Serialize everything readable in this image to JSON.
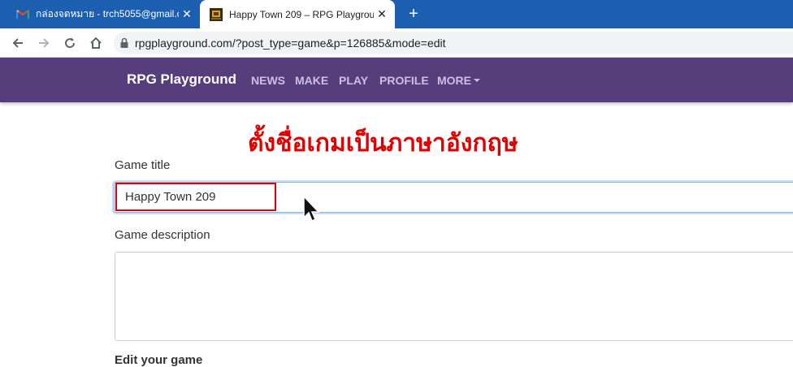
{
  "browser": {
    "tabs": [
      {
        "title": "กล่องจดหมาย - trch5055@gmail.co",
        "favicon": "gmail-icon",
        "active": false
      },
      {
        "title": "Happy Town 209 – RPG Playgrou",
        "favicon": "game-icon",
        "active": true
      }
    ],
    "close_glyph": "✕",
    "new_tab_glyph": "+",
    "address": "rpgplayground.com/?post_type=game&p=126885&mode=edit",
    "tabstrip_color": "#1c5fb0"
  },
  "site": {
    "brand": "RPG Playground",
    "nav": [
      "NEWS",
      "MAKE",
      "PLAY",
      "PROFILE",
      "MORE"
    ],
    "header_color": "#563d7c"
  },
  "annotation": {
    "text": "ตั้งชื่อเกมเป็นภาษาอังกฤษ",
    "color": "#e00000"
  },
  "form": {
    "title_label": "Game title",
    "title_value": "Happy Town 209",
    "description_label": "Game description",
    "description_value": "",
    "edit_heading": "Edit your game"
  }
}
